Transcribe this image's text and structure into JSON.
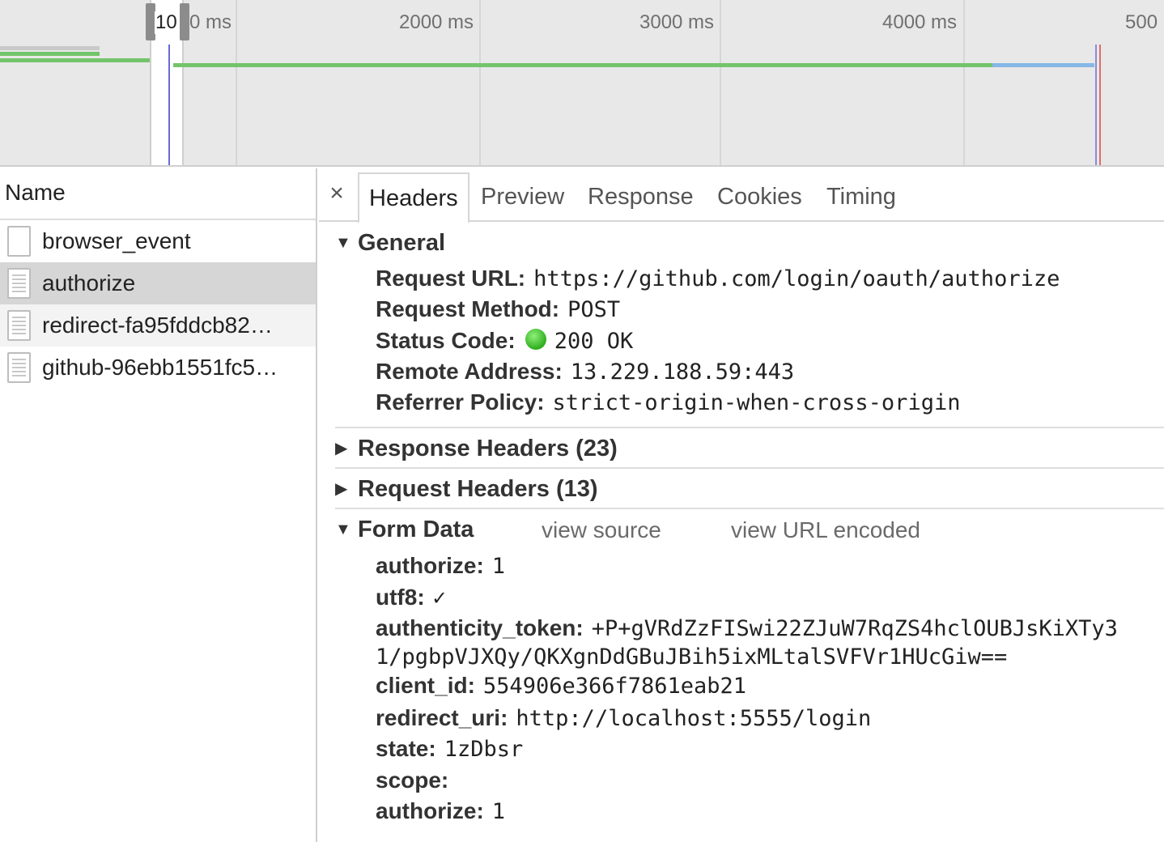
{
  "timeline": {
    "selection_label": "10",
    "ticks": [
      "0 ms",
      "2000 ms",
      "3000 ms",
      "4000 ms",
      "500"
    ],
    "colors": {
      "waiting": "#73c46b",
      "download": "#86b7e6",
      "dom_loaded": "#6b6bd6",
      "load": "#e06b6b"
    }
  },
  "name_panel": {
    "header": "Name",
    "requests": [
      {
        "name": "browser_event",
        "icon": "blank-file-icon"
      },
      {
        "name": "authorize",
        "icon": "document-icon",
        "selected": true
      },
      {
        "name": "redirect-fa95fddcb82…",
        "icon": "document-icon"
      },
      {
        "name": "github-96ebb1551fc5…",
        "icon": "document-icon"
      }
    ]
  },
  "tabs": {
    "close": "×",
    "items": [
      "Headers",
      "Preview",
      "Response",
      "Cookies",
      "Timing"
    ],
    "active": "Headers"
  },
  "general": {
    "title": "General",
    "request_url_label": "Request URL:",
    "request_url": "https://github.com/login/oauth/authorize",
    "request_method_label": "Request Method:",
    "request_method": "POST",
    "status_code_label": "Status Code:",
    "status_code": "200 OK",
    "remote_address_label": "Remote Address:",
    "remote_address": "13.229.188.59:443",
    "referrer_policy_label": "Referrer Policy:",
    "referrer_policy": "strict-origin-when-cross-origin"
  },
  "response_headers": {
    "title": "Response Headers (23)"
  },
  "request_headers": {
    "title": "Request Headers (13)"
  },
  "form_data": {
    "title": "Form Data",
    "view_source": "view source",
    "view_url_encoded": "view URL encoded",
    "authorize_label": "authorize:",
    "authorize": "1",
    "utf8_label": "utf8:",
    "utf8": "✓",
    "token_label": "authenticity_token:",
    "token_line1": "+P+gVRdZzFISwi22ZJuW7RqZS4hclOUBJsKiXTy3",
    "token_line2": "1/pgbpVJXQy/QKXgnDdGBuJBih5ixMLtalSVFVr1HUcGiw==",
    "client_id_label": "client_id:",
    "client_id": "554906e366f7861eab21",
    "redirect_uri_label": "redirect_uri:",
    "redirect_uri": "http://localhost:5555/login",
    "state_label": "state:",
    "state": "1zDbsr",
    "scope_label": "scope:",
    "scope": "",
    "authorize2_label": "authorize:",
    "authorize2": "1"
  }
}
